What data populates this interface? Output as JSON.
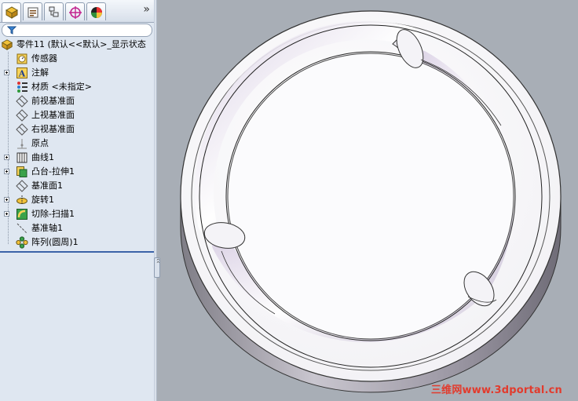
{
  "tabs": [
    {
      "icon": "feature-manager-icon"
    },
    {
      "icon": "property-manager-icon"
    },
    {
      "icon": "configuration-manager-icon"
    },
    {
      "icon": "dimxpert-icon"
    },
    {
      "icon": "display-manager-icon"
    }
  ],
  "more_symbol": "»",
  "tree": {
    "root_label": "零件11 (默认<<默认>_显示状态",
    "items": [
      {
        "label": "传感器",
        "icon": "sensor-icon",
        "expandable": false
      },
      {
        "label": "注解",
        "icon": "annotation-icon",
        "expandable": true
      },
      {
        "label": "材质 <未指定>",
        "icon": "material-icon",
        "expandable": false
      },
      {
        "label": "前视基准面",
        "icon": "plane-icon",
        "expandable": false
      },
      {
        "label": "上视基准面",
        "icon": "plane-icon",
        "expandable": false
      },
      {
        "label": "右视基准面",
        "icon": "plane-icon",
        "expandable": false
      },
      {
        "label": "原点",
        "icon": "origin-icon",
        "expandable": false
      },
      {
        "label": "曲线1",
        "icon": "curve-icon",
        "expandable": true
      },
      {
        "label": "凸台-拉伸1",
        "icon": "extrude-icon",
        "expandable": true
      },
      {
        "label": "基准面1",
        "icon": "plane-icon",
        "expandable": false
      },
      {
        "label": "旋转1",
        "icon": "revolve-icon",
        "expandable": true
      },
      {
        "label": "切除-扫描1",
        "icon": "sweep-cut-icon",
        "expandable": true
      },
      {
        "label": "基准轴1",
        "icon": "axis-icon",
        "expandable": false
      },
      {
        "label": "阵列(圆周)1",
        "icon": "circular-pattern-icon",
        "expandable": false
      }
    ]
  },
  "splitter_arrows": "‹‹",
  "watermark": "三维网www.3dportal.cn",
  "colors": {
    "panel_bg": "#dfe7f1",
    "viewport_bg": "#a8aeb6",
    "selection_line": "#3c63a8",
    "watermark": "#e23b2d"
  }
}
